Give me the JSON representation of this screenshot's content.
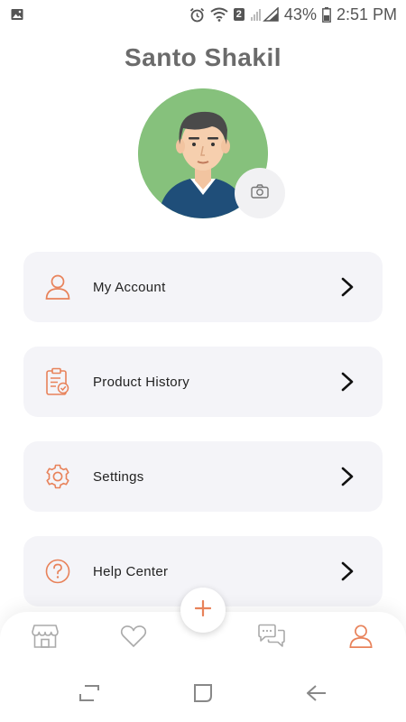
{
  "status_bar": {
    "battery_percent": "43%",
    "time": "2:51 PM",
    "sim_badge": "2",
    "icons": [
      "gallery-notification-icon",
      "alarm-icon",
      "wifi-icon",
      "signal-icon",
      "battery-icon"
    ]
  },
  "profile": {
    "name": "Santo Shakil",
    "avatar": "avatar-illustration",
    "camera_icon": "camera-icon"
  },
  "menu": [
    {
      "label": "My Account",
      "icon": "user-icon"
    },
    {
      "label": "Product History",
      "icon": "clipboard-check-icon"
    },
    {
      "label": "Settings",
      "icon": "gear-icon"
    },
    {
      "label": "Help Center",
      "icon": "help-circle-icon"
    }
  ],
  "bottom_nav": {
    "items": [
      "store-icon",
      "heart-icon",
      "chat-icon",
      "user-icon"
    ],
    "active": "user-icon",
    "fab_icon": "plus-icon"
  },
  "colors": {
    "accent": "#e8825a",
    "card_bg": "#f4f4f8",
    "avatar_bg": "#86c17c",
    "name_text": "#6b6b6b"
  }
}
